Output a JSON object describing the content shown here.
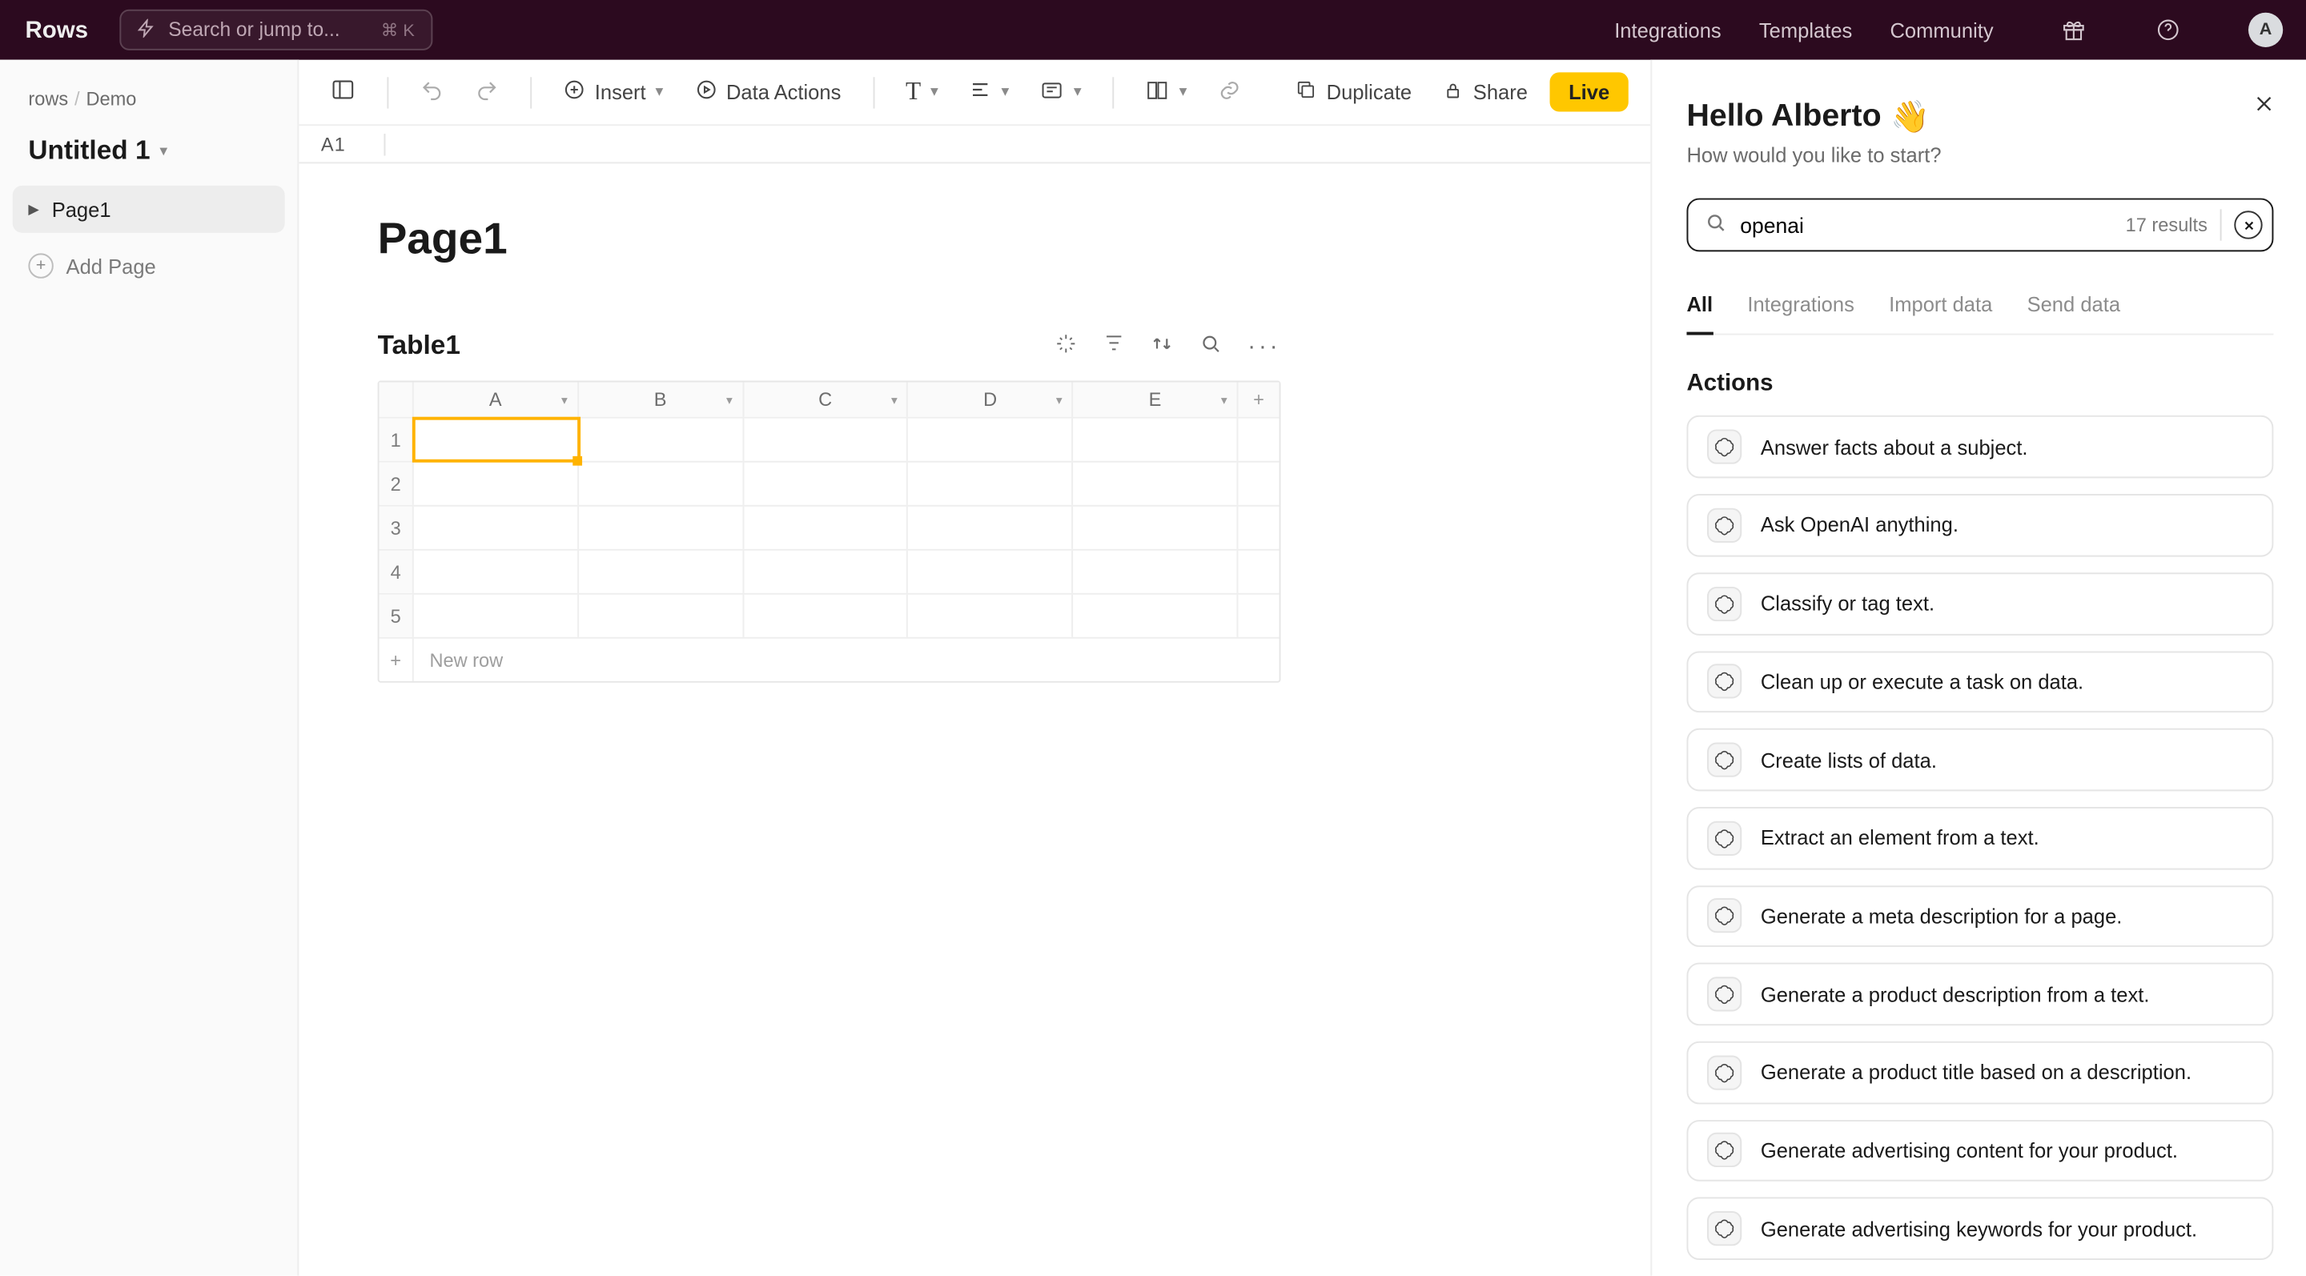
{
  "topbar": {
    "brand": "Rows",
    "search_placeholder": "Search or jump to...",
    "search_shortcut": "⌘ K",
    "nav": {
      "integrations": "Integrations",
      "templates": "Templates",
      "community": "Community"
    },
    "avatar_initial": "A"
  },
  "sidebar": {
    "crumb_root": "rows",
    "crumb_leaf": "Demo",
    "doc_title": "Untitled 1",
    "pages": [
      {
        "label": "Page1"
      }
    ],
    "add_page_label": "Add Page"
  },
  "toolbar": {
    "insert_label": "Insert",
    "data_actions_label": "Data Actions",
    "duplicate_label": "Duplicate",
    "share_label": "Share",
    "live_label": "Live"
  },
  "formula_bar": {
    "active_cell": "A1"
  },
  "page": {
    "title": "Page1",
    "table_title": "Table1",
    "columns": [
      "A",
      "B",
      "C",
      "D",
      "E"
    ],
    "row_numbers": [
      "1",
      "2",
      "3",
      "4",
      "5"
    ],
    "new_row_label": "New row"
  },
  "panel": {
    "greeting_name": "Hello Alberto",
    "greeting_emoji": "👋",
    "subtitle": "How would you like to start?",
    "search_value": "openai",
    "results_text": "17 results",
    "tabs": {
      "all": "All",
      "integrations": "Integrations",
      "import": "Import data",
      "send": "Send data"
    },
    "section_title": "Actions",
    "actions": [
      "Answer facts about a subject.",
      "Ask OpenAI anything.",
      "Classify or tag text.",
      "Clean up or execute a task on data.",
      "Create lists of data.",
      "Extract an element from a text.",
      "Generate a meta description for a page.",
      "Generate a product description from a text.",
      "Generate a product title based on a description.",
      "Generate advertising content for your product.",
      "Generate advertising keywords for your product."
    ]
  }
}
